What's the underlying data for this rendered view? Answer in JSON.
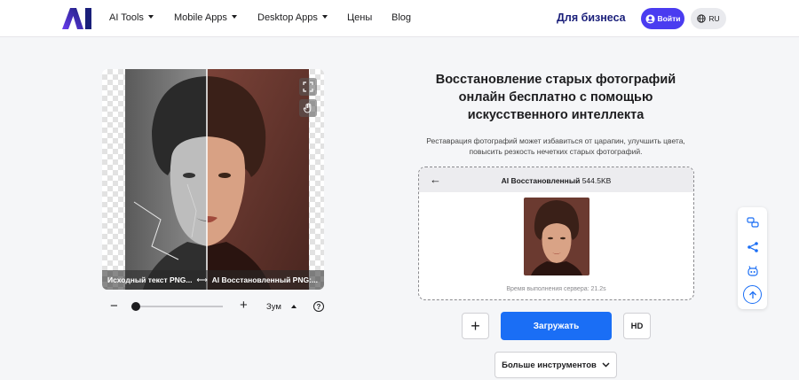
{
  "header": {
    "nav": [
      {
        "label": "AI Tools",
        "dropdown": true
      },
      {
        "label": "Mobile Apps",
        "dropdown": true
      },
      {
        "label": "Desktop Apps",
        "dropdown": true
      },
      {
        "label": "Цены",
        "dropdown": false
      },
      {
        "label": "Blog",
        "dropdown": false
      }
    ],
    "business_label": "Для бизнеса",
    "login_label": "Войти",
    "lang_label": "RU"
  },
  "compare": {
    "left_label": "Исходный текст PNG...",
    "arrow": "⟷",
    "right_label": "AI Восстановленный PNG:..."
  },
  "zoom": {
    "minus": "−",
    "plus": "+",
    "label": "Зум",
    "help": "?",
    "level": 0
  },
  "main": {
    "title": "Восстановление старых фотографий онлайн бесплатно с помощью искусственного интеллекта",
    "description": "Реставрация фотографий может избавиться от царапин, улучшить цвета, повысить резкость нечетких старых фотографий."
  },
  "result": {
    "back": "←",
    "title": "AI Восстановленный",
    "size": "544.5KB",
    "time": "Время выполнения сервера: 21.2s"
  },
  "actions": {
    "add": "+",
    "upload": "Загружать",
    "hd": "HD",
    "more": "Больше инструментов"
  },
  "colors": {
    "accent": "#1a6ef5",
    "login": "#4a3cf0",
    "brand_dark": "#1a1f7a",
    "side_icon": "#1a6ef5"
  }
}
